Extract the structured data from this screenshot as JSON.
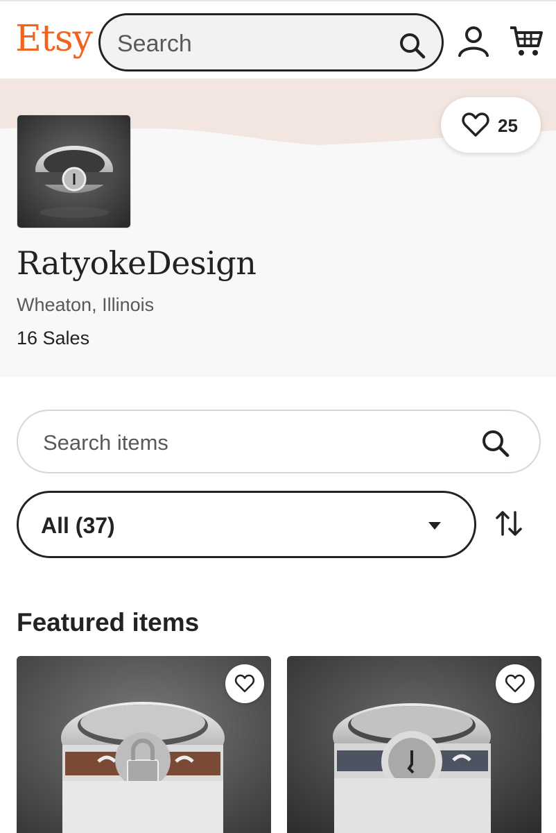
{
  "header": {
    "logo": "Etsy",
    "search_placeholder": "Search",
    "icons": [
      "search-icon",
      "user-icon",
      "cart-icon"
    ],
    "brand_color": "#f1641e"
  },
  "shop": {
    "name": "RatyokeDesign",
    "location": "Wheaton, Illinois",
    "sales": "16 Sales",
    "favorites_count": "25"
  },
  "item_search": {
    "placeholder": "Search items"
  },
  "filter": {
    "selected": "All (37)"
  },
  "featured": {
    "title": "Featured items",
    "items": [
      {
        "image": "silver-copper-padlock-ring",
        "favorite_icon": "heart-icon"
      },
      {
        "image": "silver-keyhole-ring",
        "favorite_icon": "heart-icon"
      }
    ]
  }
}
